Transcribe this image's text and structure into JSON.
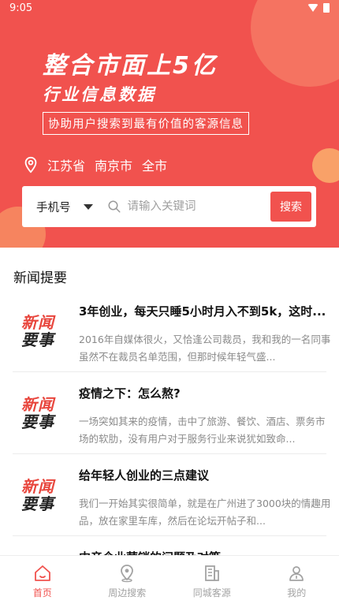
{
  "status": {
    "time": "9:05"
  },
  "hero": {
    "headline": "整合市面上5亿",
    "subheadline": "行业信息数据",
    "tagline": "协助用户搜索到最有价值的客源信息"
  },
  "location": {
    "province": "江苏省",
    "city": "南京市",
    "district": "全市"
  },
  "search": {
    "type_selected": "手机号",
    "placeholder": "请输入关键词",
    "button": "搜索"
  },
  "section": {
    "title": "新闻提要"
  },
  "news_logo": {
    "line1": "新闻",
    "line2": "要事"
  },
  "news": [
    {
      "title": "3年创业，每天只睡5小时月入不到5k，这时...",
      "desc": "2016年自媒体很火，又恰逢公司裁员，我和我的一名同事虽然不在裁员名单范围，但那时候年轻气盛..."
    },
    {
      "title": "疫情之下：怎么熬?",
      "desc": "一场突如其来的疫情，击中了旅游、餐饮、酒店、票务市场的软肋，没有用户对于服务行业来说犹如致命..."
    },
    {
      "title": "给年轻人创业的三点建议",
      "desc": "我们一开始其实很简单，就是在广州进了3000块的情趣用品，放在家里车库，然后在论坛开帖子和..."
    },
    {
      "title": "中音企业营销的问题及对策",
      "desc": ""
    }
  ],
  "tabs": [
    {
      "label": "首页",
      "icon": "home-icon",
      "active": true
    },
    {
      "label": "周边搜索",
      "icon": "location-pin-icon",
      "active": false
    },
    {
      "label": "同城客源",
      "icon": "building-icon",
      "active": false
    },
    {
      "label": "我的",
      "icon": "user-icon",
      "active": false
    }
  ],
  "colors": {
    "accent": "#f1524e",
    "inactive_tab": "#a3a3a3"
  }
}
